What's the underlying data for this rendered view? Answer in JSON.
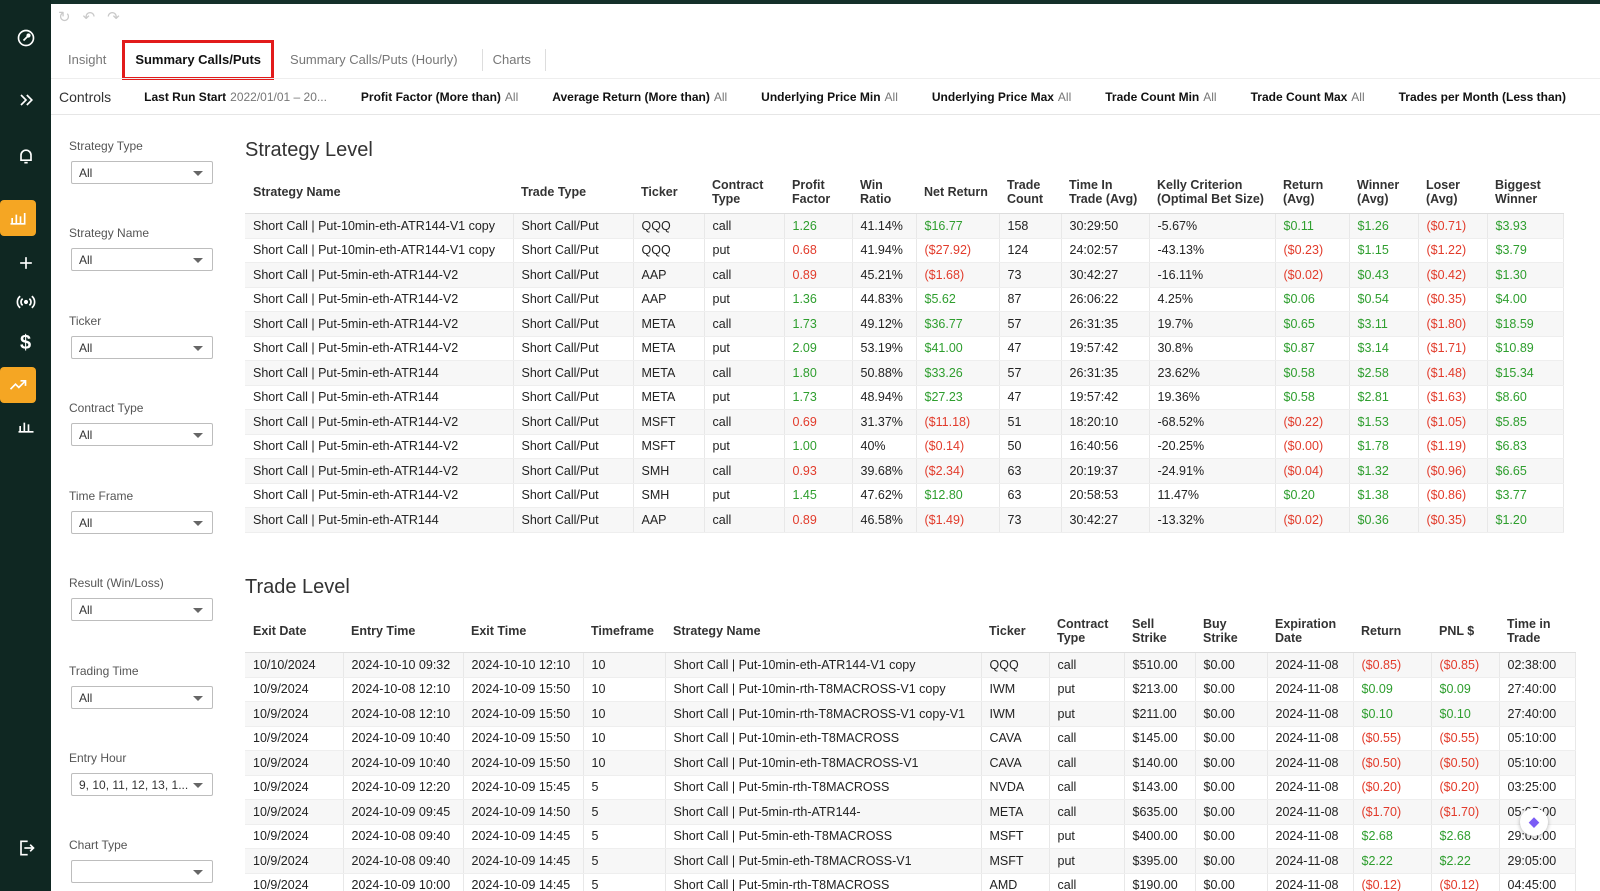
{
  "toolbar": {
    "undo_icons": [
      "↻",
      "↶",
      "↷"
    ]
  },
  "tabs": [
    {
      "label": "Insight",
      "active": false
    },
    {
      "label": "Summary Calls/Puts",
      "active": true
    },
    {
      "label": "Summary Calls/Puts (Hourly)",
      "active": false
    },
    {
      "label": "Charts",
      "active": false
    }
  ],
  "controls": {
    "title": "Controls",
    "items": [
      {
        "label": "Last Run Start",
        "value": "2022/01/01 – 20..."
      },
      {
        "label": "Profit Factor (More than)",
        "value": "All"
      },
      {
        "label": "Average Return (More than)",
        "value": "All"
      },
      {
        "label": "Underlying Price Min",
        "value": "All"
      },
      {
        "label": "Underlying Price Max",
        "value": "All"
      },
      {
        "label": "Trade Count Min",
        "value": "All"
      },
      {
        "label": "Trade Count Max",
        "value": "All"
      },
      {
        "label": "Trades per Month (Less than)",
        "value": ""
      }
    ]
  },
  "filters": [
    {
      "label": "Strategy Type",
      "value": "All"
    },
    {
      "label": "Strategy Name",
      "value": "All"
    },
    {
      "label": "Ticker",
      "value": "All"
    },
    {
      "label": "Contract Type",
      "value": "All"
    },
    {
      "label": "Time Frame",
      "value": "All"
    },
    {
      "label": "Result (Win/Loss)",
      "value": "All"
    },
    {
      "label": "Trading Time",
      "value": "All"
    },
    {
      "label": "Entry Hour",
      "value": "9, 10, 11, 12, 13, 1..."
    },
    {
      "label": "Chart Type",
      "value": ""
    }
  ],
  "strategy": {
    "title": "Strategy Level",
    "headers": [
      "Strategy Name",
      "Trade Type",
      "Ticker",
      "Contract Type",
      "Profit Factor",
      "Win Ratio",
      "Net Return",
      "Trade Count",
      "Time In Trade (Avg)",
      "Kelly Criterion (Optimal Bet Size)",
      "Return (Avg)",
      "Winner (Avg)",
      "Loser (Avg)",
      "Biggest Winner"
    ],
    "rows": [
      [
        "Short Call | Put-10min-eth-ATR144-V1 copy",
        "Short Call/Put",
        "QQQ",
        "call",
        "1.26",
        "41.14%",
        "$16.77",
        "158",
        "30:29:50",
        "-5.67%",
        "$0.11",
        "$1.26",
        "($0.71)",
        "$3.93"
      ],
      [
        "Short Call | Put-10min-eth-ATR144-V1 copy",
        "Short Call/Put",
        "QQQ",
        "put",
        "0.68",
        "41.94%",
        "($27.92)",
        "124",
        "24:02:57",
        "-43.13%",
        "($0.23)",
        "$1.15",
        "($1.22)",
        "$3.79"
      ],
      [
        "Short Call | Put-5min-eth-ATR144-V2",
        "Short Call/Put",
        "AAP",
        "call",
        "0.89",
        "45.21%",
        "($1.68)",
        "73",
        "30:42:27",
        "-16.11%",
        "($0.02)",
        "$0.43",
        "($0.42)",
        "$1.30"
      ],
      [
        "Short Call | Put-5min-eth-ATR144-V2",
        "Short Call/Put",
        "AAP",
        "put",
        "1.36",
        "44.83%",
        "$5.62",
        "87",
        "26:06:22",
        "4.25%",
        "$0.06",
        "$0.54",
        "($0.35)",
        "$4.00"
      ],
      [
        "Short Call | Put-5min-eth-ATR144-V2",
        "Short Call/Put",
        "META",
        "call",
        "1.73",
        "49.12%",
        "$36.77",
        "57",
        "26:31:35",
        "19.7%",
        "$0.65",
        "$3.11",
        "($1.80)",
        "$18.59"
      ],
      [
        "Short Call | Put-5min-eth-ATR144-V2",
        "Short Call/Put",
        "META",
        "put",
        "2.09",
        "53.19%",
        "$41.00",
        "47",
        "19:57:42",
        "30.8%",
        "$0.87",
        "$3.14",
        "($1.71)",
        "$10.89"
      ],
      [
        "Short Call | Put-5min-eth-ATR144",
        "Short Call/Put",
        "META",
        "call",
        "1.80",
        "50.88%",
        "$33.26",
        "57",
        "26:31:35",
        "23.62%",
        "$0.58",
        "$2.58",
        "($1.48)",
        "$15.34"
      ],
      [
        "Short Call | Put-5min-eth-ATR144",
        "Short Call/Put",
        "META",
        "put",
        "1.73",
        "48.94%",
        "$27.23",
        "47",
        "19:57:42",
        "19.36%",
        "$0.58",
        "$2.81",
        "($1.63)",
        "$8.60"
      ],
      [
        "Short Call | Put-5min-eth-ATR144-V2",
        "Short Call/Put",
        "MSFT",
        "call",
        "0.69",
        "31.37%",
        "($11.18)",
        "51",
        "18:20:10",
        "-68.52%",
        "($0.22)",
        "$1.53",
        "($1.05)",
        "$5.85"
      ],
      [
        "Short Call | Put-5min-eth-ATR144-V2",
        "Short Call/Put",
        "MSFT",
        "put",
        "1.00",
        "40%",
        "($0.14)",
        "50",
        "16:40:56",
        "-20.25%",
        "($0.00)",
        "$1.78",
        "($1.19)",
        "$6.83"
      ],
      [
        "Short Call | Put-5min-eth-ATR144-V2",
        "Short Call/Put",
        "SMH",
        "call",
        "0.93",
        "39.68%",
        "($2.34)",
        "63",
        "20:19:37",
        "-24.91%",
        "($0.04)",
        "$1.32",
        "($0.96)",
        "$6.65"
      ],
      [
        "Short Call | Put-5min-eth-ATR144-V2",
        "Short Call/Put",
        "SMH",
        "put",
        "1.45",
        "47.62%",
        "$12.80",
        "63",
        "20:58:53",
        "11.47%",
        "$0.20",
        "$1.38",
        "($0.86)",
        "$3.77"
      ],
      [
        "Short Call | Put-5min-eth-ATR144",
        "Short Call/Put",
        "AAP",
        "call",
        "0.89",
        "46.58%",
        "($1.49)",
        "73",
        "30:42:27",
        "-13.32%",
        "($0.02)",
        "$0.36",
        "($0.35)",
        "$1.20"
      ]
    ]
  },
  "trade": {
    "title": "Trade Level",
    "headers": [
      "Exit Date",
      "Entry Time",
      "Exit Time",
      "Timeframe",
      "Strategy Name",
      "Ticker",
      "Contract Type",
      "Sell Strike",
      "Buy Strike",
      "Expiration Date",
      "Return",
      "PNL $",
      "Time in Trade"
    ],
    "rows": [
      [
        "10/10/2024",
        "2024-10-10 09:32",
        "2024-10-10 12:10",
        "10",
        "Short Call | Put-10min-eth-ATR144-V1 copy",
        "QQQ",
        "call",
        "$510.00",
        "$0.00",
        "2024-11-08",
        "($0.85)",
        "($0.85)",
        "02:38:00"
      ],
      [
        "10/9/2024",
        "2024-10-08 12:10",
        "2024-10-09 15:50",
        "10",
        "Short Call | Put-10min-rth-T8MACROSS-V1 copy",
        "IWM",
        "put",
        "$213.00",
        "$0.00",
        "2024-11-08",
        "$0.09",
        "$0.09",
        "27:40:00"
      ],
      [
        "10/9/2024",
        "2024-10-08 12:10",
        "2024-10-09 15:50",
        "10",
        "Short Call | Put-10min-rth-T8MACROSS-V1 copy-V1",
        "IWM",
        "put",
        "$211.00",
        "$0.00",
        "2024-11-08",
        "$0.10",
        "$0.10",
        "27:40:00"
      ],
      [
        "10/9/2024",
        "2024-10-09 10:40",
        "2024-10-09 15:50",
        "10",
        "Short Call | Put-10min-eth-T8MACROSS",
        "CAVA",
        "call",
        "$145.00",
        "$0.00",
        "2024-11-08",
        "($0.55)",
        "($0.55)",
        "05:10:00"
      ],
      [
        "10/9/2024",
        "2024-10-09 10:40",
        "2024-10-09 15:50",
        "10",
        "Short Call | Put-10min-eth-T8MACROSS-V1",
        "CAVA",
        "call",
        "$140.00",
        "$0.00",
        "2024-11-08",
        "($0.50)",
        "($0.50)",
        "05:10:00"
      ],
      [
        "10/9/2024",
        "2024-10-09 12:20",
        "2024-10-09 15:45",
        "5",
        "Short Call | Put-5min-rth-T8MACROSS",
        "NVDA",
        "call",
        "$143.00",
        "$0.00",
        "2024-11-08",
        "($0.20)",
        "($0.20)",
        "03:25:00"
      ],
      [
        "10/9/2024",
        "2024-10-09 09:45",
        "2024-10-09 14:50",
        "5",
        "Short Call | Put-5min-rth-ATR144-",
        "META",
        "call",
        "$635.00",
        "$0.00",
        "2024-11-08",
        "($1.70)",
        "($1.70)",
        "05:05:00"
      ],
      [
        "10/9/2024",
        "2024-10-08 09:40",
        "2024-10-09 14:45",
        "5",
        "Short Call | Put-5min-eth-T8MACROSS",
        "MSFT",
        "put",
        "$400.00",
        "$0.00",
        "2024-11-08",
        "$2.68",
        "$2.68",
        "29:05:00"
      ],
      [
        "10/9/2024",
        "2024-10-08 09:40",
        "2024-10-09 14:45",
        "5",
        "Short Call | Put-5min-eth-T8MACROSS-V1",
        "MSFT",
        "put",
        "$395.00",
        "$0.00",
        "2024-11-08",
        "$2.22",
        "$2.22",
        "29:05:00"
      ],
      [
        "10/9/2024",
        "2024-10-09 10:00",
        "2024-10-09 14:45",
        "5",
        "Short Call | Put-5min-rth-T8MACROSS",
        "AMD",
        "call",
        "$190.00",
        "$0.00",
        "2024-11-08",
        "($0.12)",
        "($0.12)",
        "04:45:00"
      ]
    ]
  },
  "colors": {
    "positive": "#2e9e2e",
    "negative": "#e23b2b",
    "accent": "#f5a623",
    "sidebar": "#0f2722",
    "highlight": "#e21b1b"
  },
  "sidebar_icons": [
    "logo-icon",
    "expand-icon",
    "bell-icon",
    "bar-chart-icon",
    "plus-icon",
    "broadcast-icon",
    "dollar-icon",
    "trending-icon",
    "bar-chart-2-icon",
    "logout-icon"
  ]
}
